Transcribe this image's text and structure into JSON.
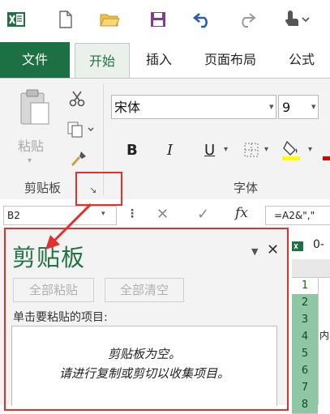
{
  "quick_access": {
    "icons": [
      "excel-logo-icon",
      "new-file-icon",
      "open-folder-icon",
      "save-icon",
      "undo-icon",
      "redo-icon",
      "touch-mode-icon"
    ]
  },
  "tabs": {
    "file": "文件",
    "home": "开始",
    "insert": "插入",
    "page_layout": "页面布局",
    "formulas": "公式"
  },
  "ribbon": {
    "clipboard": {
      "paste": "粘贴",
      "group_label": "剪贴板"
    },
    "font": {
      "font_name": "宋体",
      "font_size": "9",
      "bold": "B",
      "italic": "I",
      "underline": "U",
      "group_label": "字体"
    }
  },
  "formula_bar": {
    "name_box": "B2",
    "formula_text": "=A2&\",\"",
    "fx": "fx"
  },
  "clipboard_pane": {
    "title": "剪贴板",
    "paste_all": "全部粘贴",
    "clear_all": "全部清空",
    "instruction": "单击要粘贴的项目:",
    "empty_line1": "剪贴板为空。",
    "empty_line2": "请进行复制或剪切以收集项目。"
  },
  "sheet": {
    "tab_hint": "0-",
    "row_numbers": [
      "1",
      "2",
      "3",
      "4",
      "5",
      "6",
      "7",
      "8"
    ],
    "cell_a4_fragment": "内"
  },
  "colors": {
    "accent_green": "#217346",
    "file_tab": "#1d7044",
    "annotation_red": "#e2302c"
  }
}
